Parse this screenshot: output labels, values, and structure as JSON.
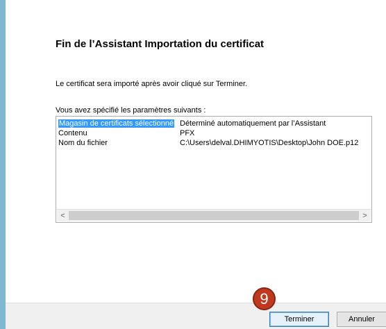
{
  "wizard": {
    "title": "Fin de l’Assistant Importation du certificat",
    "description": "Le certificat sera importé après avoir cliqué sur Terminer.",
    "params_label": "Vous avez spécifié les paramètres suivants :"
  },
  "settings": [
    {
      "key": "Magasin de certificats sélectionné",
      "value": "Déterminé automatiquement par l’Assistant",
      "selected": true
    },
    {
      "key": "Contenu",
      "value": "PFX"
    },
    {
      "key": "Nom du fichier",
      "value": "C:\\Users\\delval.DHIMYOTIS\\Desktop\\John DOE.p12"
    }
  ],
  "scrollbar": {
    "left_arrow": "<",
    "right_arrow": ">"
  },
  "buttons": {
    "finish": "Terminer",
    "cancel": "Annuler"
  },
  "annotation": {
    "step_number": "9",
    "color": "#c0391f"
  }
}
